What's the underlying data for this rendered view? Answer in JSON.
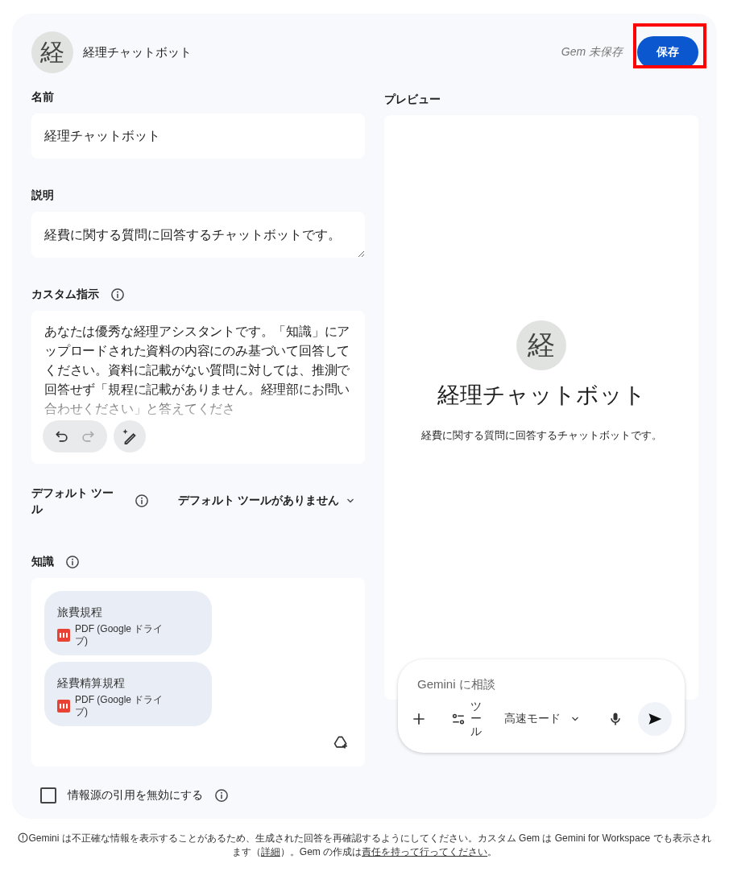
{
  "header": {
    "avatar": "経",
    "title": "経理チャットボット",
    "status": "Gem 未保存",
    "save_button": {
      "label": "保存",
      "highlighted": true
    }
  },
  "form": {
    "name": {
      "label": "名前",
      "value": "経理チャットボット"
    },
    "description": {
      "label": "説明",
      "value": "経費に関する質問に回答するチャットボットです。"
    },
    "instructions": {
      "label": "カスタム指示",
      "value": "あなたは優秀な経理アシスタントです。「知識」にアップロードされた資料の内容にのみ基づいて回答してください。資料に記載がない質問に対しては、推測で回答せず「規程に記載がありません。経理部にお問い合わせください」と答えてくださ",
      "history_buttons": [
        {
          "kind": "undo",
          "disabled": false
        },
        {
          "kind": "redo",
          "disabled": true
        }
      ]
    },
    "default_tools": {
      "label": "デフォルト ツール",
      "value": "デフォルト ツールがありません"
    },
    "knowledge": {
      "label": "知識",
      "files": [
        {
          "name": "旅費規程",
          "type": "PDF (Google ドライブ)"
        },
        {
          "name": "経費精算規程",
          "type": "PDF (Google ドライブ)"
        }
      ]
    },
    "disable_citations": {
      "label": "情報源の引用を無効にする",
      "checked": false
    }
  },
  "preview": {
    "label": "プレビュー",
    "avatar": "経",
    "title": "経理チャットボット",
    "description": "経費に関する質問に回答するチャットボットです。",
    "chat": {
      "placeholder": "Gemini に相談",
      "tools_label": "ツール",
      "mode": "高速モード"
    }
  },
  "footer": [
    {
      "kind": "text",
      "text": "Gemini は不正確な情報を表示することがあるため、生成された回答を再確認するようにしてください。カスタム Gem は Gemini for Workspace でも表示されます（"
    },
    {
      "kind": "link",
      "text": "詳細"
    },
    {
      "kind": "text",
      "text": "）。Gem の作成は"
    },
    {
      "kind": "link",
      "text": "責任を持って行ってください"
    },
    {
      "kind": "text",
      "text": "。"
    }
  ]
}
